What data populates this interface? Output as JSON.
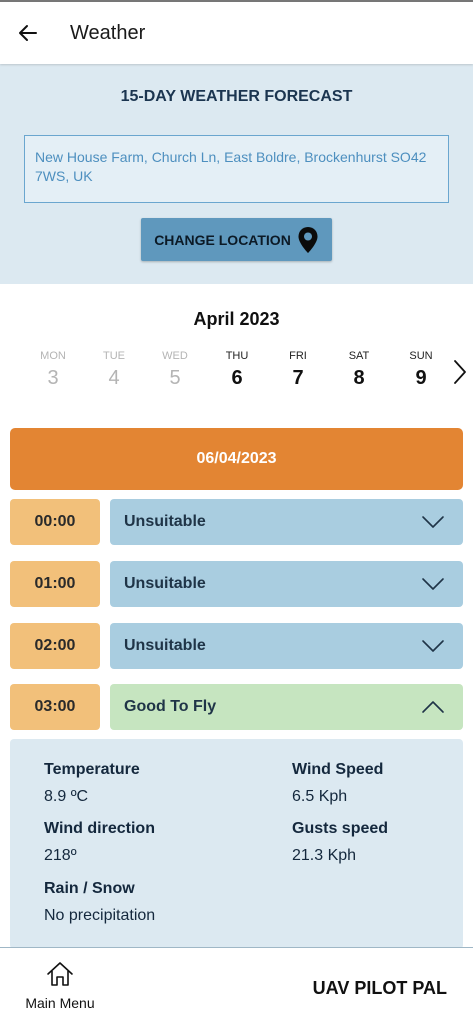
{
  "header": {
    "title": "Weather"
  },
  "forecast": {
    "heading": "15-DAY WEATHER FORECAST",
    "location": "New House Farm, Church Ln, East Boldre, Brockenhurst SO42 7WS, UK",
    "change_label": "CHANGE LOCATION"
  },
  "calendar": {
    "month": "April 2023",
    "days": [
      {
        "name": "MON",
        "num": "3",
        "state": "past"
      },
      {
        "name": "TUE",
        "num": "4",
        "state": "past"
      },
      {
        "name": "WED",
        "num": "5",
        "state": "past"
      },
      {
        "name": "THU",
        "num": "6",
        "state": "future"
      },
      {
        "name": "FRI",
        "num": "7",
        "state": "future"
      },
      {
        "name": "SAT",
        "num": "8",
        "state": "future"
      },
      {
        "name": "SUN",
        "num": "9",
        "state": "future"
      }
    ]
  },
  "selected_date": "06/04/2023",
  "hours": [
    {
      "time": "00:00",
      "status": "Unsuitable",
      "expanded": false
    },
    {
      "time": "01:00",
      "status": "Unsuitable",
      "expanded": false
    },
    {
      "time": "02:00",
      "status": "Unsuitable",
      "expanded": false
    },
    {
      "time": "03:00",
      "status": "Good To Fly",
      "expanded": true
    }
  ],
  "detail": {
    "temperature_label": "Temperature",
    "temperature_value": "8.9 ºC",
    "wind_direction_label": "Wind direction",
    "wind_direction_value": "218º",
    "rain_label": "Rain / Snow",
    "rain_value": "No precipitation",
    "wind_speed_label": "Wind Speed",
    "wind_speed_value": "6.5 Kph",
    "gusts_label": "Gusts speed",
    "gusts_value": "21.3 Kph"
  },
  "footer": {
    "menu_label": "Main Menu",
    "brand": "UAV PILOT PAL"
  },
  "icons": {
    "back": "arrow-left-icon",
    "location": "map-pin-icon",
    "next": "chevron-right-icon",
    "collapsed": "chevron-down-icon",
    "expanded": "chevron-up-icon",
    "home": "home-icon"
  },
  "colors": {
    "panel": "#dce9f1",
    "button": "#5f98bd",
    "date_bar": "#e38533",
    "time_chip": "#f2c07a",
    "unsuitable": "#a9cde0",
    "good": "#c6e5c0"
  }
}
